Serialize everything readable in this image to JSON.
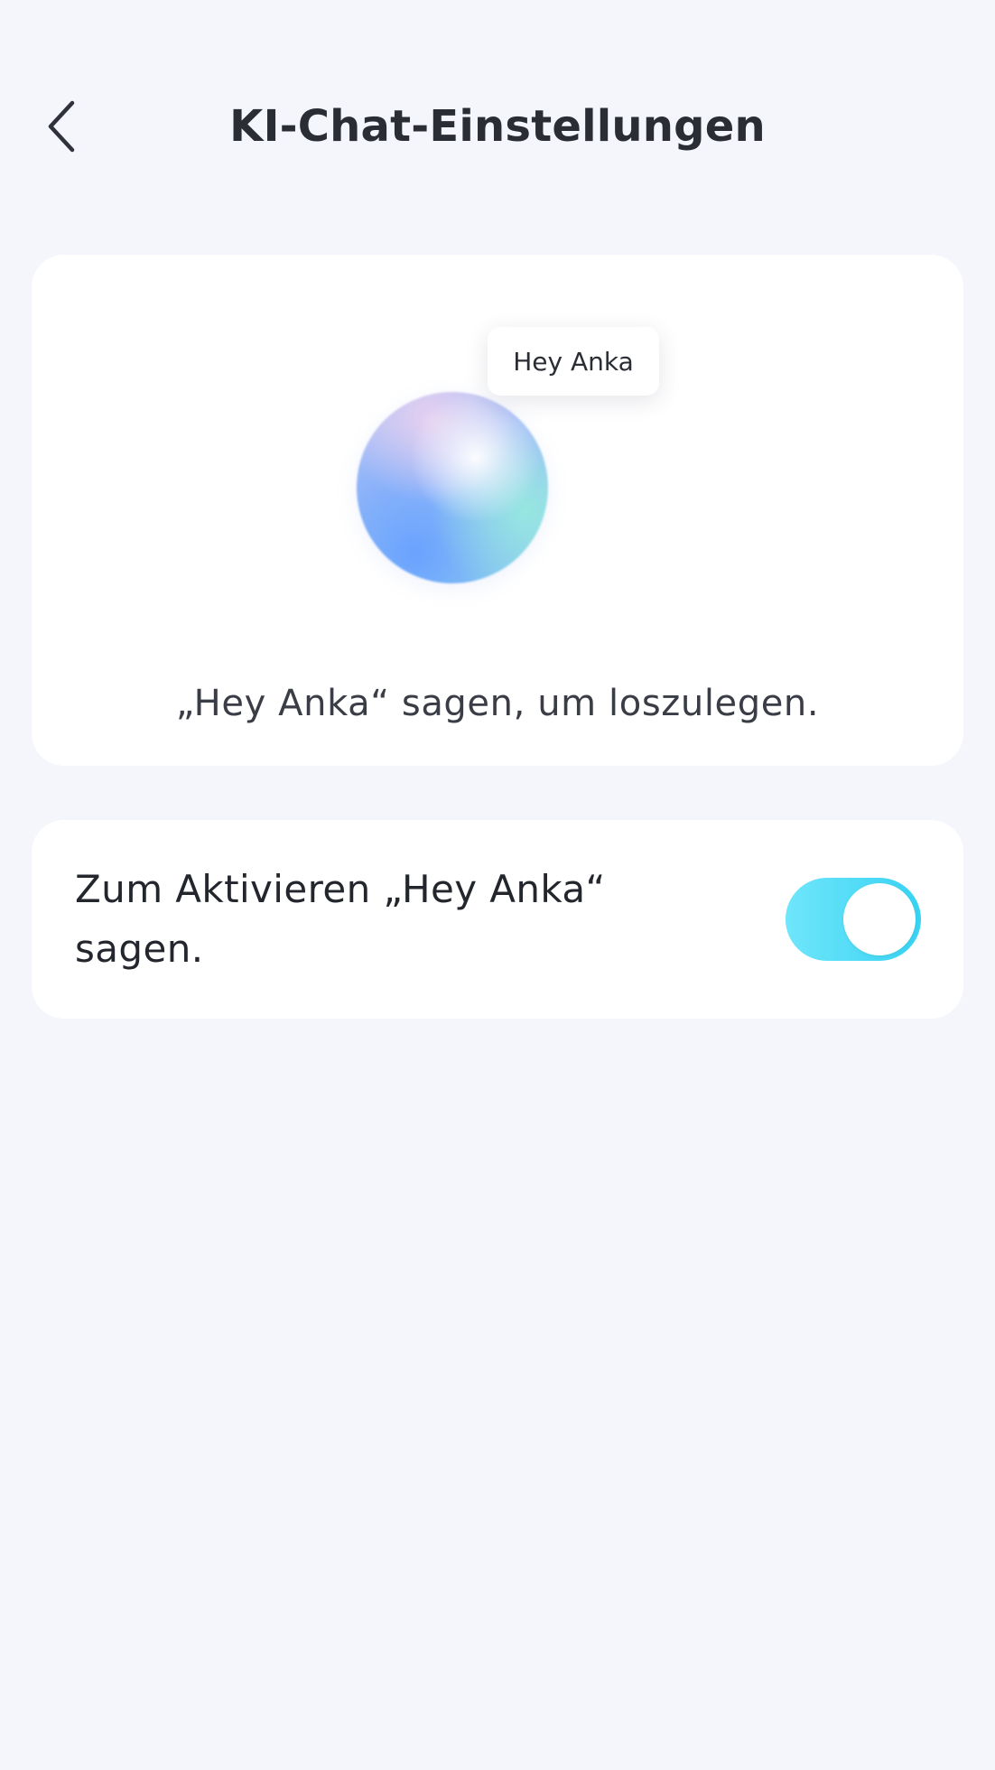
{
  "header": {
    "title": "KI-Chat-Einstellungen",
    "back_icon": "chevron-left-icon"
  },
  "hero": {
    "bubble_text": "Hey Anka",
    "caption": "„Hey Anka“ sagen, um loszulegen."
  },
  "wake_setting": {
    "label": "Zum Aktivieren „Hey Anka“ sagen.",
    "enabled": true,
    "accent_color": "#38d2f2"
  }
}
